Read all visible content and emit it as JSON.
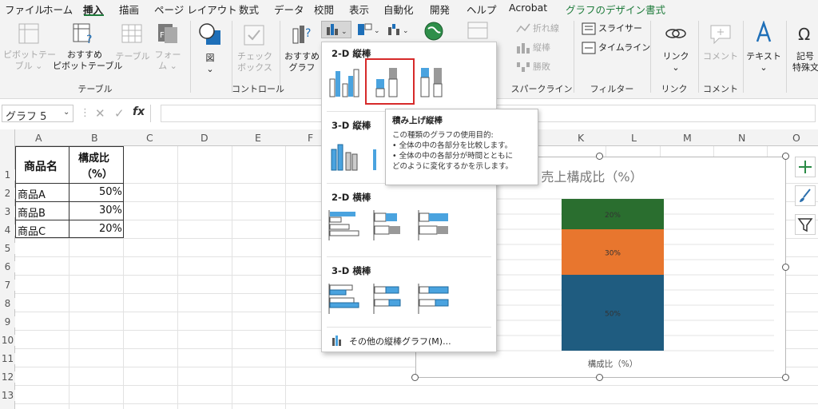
{
  "tabs": [
    "ファイル",
    "ホーム",
    "挿入",
    "描画",
    "ページ レイアウト",
    "数式",
    "データ",
    "校閲",
    "表示",
    "自動化",
    "開発",
    "ヘルプ",
    "Acrobat",
    "グラフのデザイン",
    "書式"
  ],
  "active_tab": "挿入",
  "ribbon": {
    "pivot_table": "ピボットテー\nブル ⌄",
    "recommended_pivot": "おすすめ\nピボットテーブル",
    "table": "テーブル",
    "forms": "フォー\nム ⌄",
    "illustrations": "図\n⌄",
    "checkbox": "チェック\nボックス",
    "recommended_chart": "おすすめ\nグラフ",
    "sparkline_line": "折れ線",
    "sparkline_column": "縦棒",
    "sparkline_winloss": "勝敗",
    "slicer": "スライサー",
    "timeline": "タイムライン",
    "link": "リンク\n⌄",
    "comment": "コメント",
    "text": "テキスト\n⌄",
    "symbols": "記号\n特殊文",
    "groups": {
      "table": "テーブル",
      "control": "コントロール",
      "sparklines": "スパークライン",
      "filter": "フィルター",
      "link": "リンク",
      "comment": "コメント"
    }
  },
  "formula_bar": {
    "name_box": "グラフ 5",
    "fx": "fx"
  },
  "columns": [
    "A",
    "B",
    "C",
    "D",
    "E",
    "F",
    "G",
    "H",
    "I",
    "J",
    "K",
    "L",
    "M",
    "N",
    "O"
  ],
  "rows": [
    "1",
    "2",
    "3",
    "4",
    "5",
    "6",
    "7",
    "8",
    "9",
    "10",
    "11",
    "12",
    "13"
  ],
  "table": {
    "header_name": "商品名",
    "header_ratio_line1": "構成比",
    "header_ratio_line2": "（%）",
    "rows": [
      {
        "name": "商品A",
        "ratio": "50%"
      },
      {
        "name": "商品B",
        "ratio": "30%"
      },
      {
        "name": "商品C",
        "ratio": "20%"
      }
    ]
  },
  "dropdown": {
    "section_2d_column": "2-D 縦棒",
    "section_3d_column": "3-D 縦棒",
    "section_2d_bar": "2-D 横棒",
    "section_3d_bar": "3-D 横棒",
    "more_charts": "その他の縦棒グラフ(M)..."
  },
  "tooltip": {
    "title": "積み上げ縦棒",
    "intro": "この種類のグラフの使用目的:",
    "bullet1": "• 全体の中の各部分を比較します。",
    "bullet2": "• 全体の中の各部分が時間とともに",
    "bullet2_cont": "どのように変化するかを示します。"
  },
  "chart_data": {
    "type": "bar",
    "stacked": true,
    "title": "売上構成比（%）",
    "categories": [
      "構成比（%）"
    ],
    "series": [
      {
        "values": [
          50
        ],
        "label": "50%",
        "color": "#1f5c80"
      },
      {
        "values": [
          30
        ],
        "label": "30%",
        "color": "#e8762e"
      },
      {
        "values": [
          20
        ],
        "label": "20%",
        "color": "#2a6e2f"
      }
    ],
    "ylim": [
      0,
      100
    ],
    "grid": true
  },
  "colors": {
    "excel_green": "#1e7b3b",
    "highlight_red": "#d62a2a"
  }
}
